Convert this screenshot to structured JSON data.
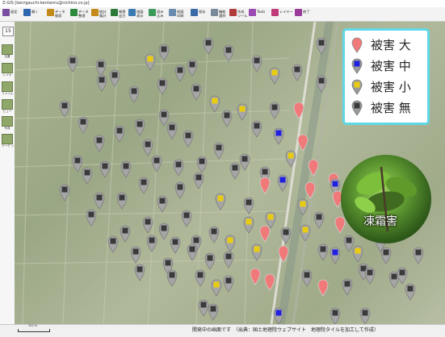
{
  "window": {
    "title": "Z-GIS [kenrgauchi-kentanru@nichino.co.jp]"
  },
  "toolbar": {
    "buttons": [
      {
        "label": "設定",
        "icon": "gear-icon",
        "color": "#7a4ea0"
      },
      {
        "label": "開く",
        "icon": "folder-icon",
        "color": "#2f66b0"
      },
      {
        "label": "データ\n検索",
        "icon": "search-icon",
        "color": "#c28a1a"
      },
      {
        "label": "データ\n整理",
        "icon": "text-tool-icon",
        "color": "#2b8a3e"
      },
      {
        "label": "統計\n集計",
        "icon": "stats-icon",
        "color": "#c48a1a"
      },
      {
        "label": "帳票\n出力",
        "icon": "report-icon",
        "color": "#2b7a3a"
      },
      {
        "label": "地図\n表示",
        "icon": "map-display-icon",
        "color": "#3a7ab0"
      },
      {
        "label": "読み\n込み",
        "icon": "import-icon",
        "color": "#3a9a5a"
      },
      {
        "label": "地図\n印刷",
        "icon": "print-icon",
        "color": "#6a8ab0"
      },
      {
        "label": "保存",
        "icon": "save-icon",
        "color": "#3a6aa8"
      },
      {
        "label": "機能\n選択",
        "icon": "function-icon",
        "color": "#7a8a9a"
      },
      {
        "label": "作成\nツール",
        "icon": "create-tool-icon",
        "color": "#b03a3a"
      },
      {
        "label": "Tools",
        "icon": "tools-icon",
        "color": "#9a4ab0"
      },
      {
        "label": "レイヤー",
        "icon": "layer-icon",
        "color": "#c03a7a"
      },
      {
        "label": "終了",
        "icon": "exit-icon",
        "color": "#9a3a9a"
      }
    ]
  },
  "sidebar": {
    "zoom": "15",
    "items": [
      {
        "label": "位置",
        "icon": "position-icon"
      },
      {
        "label": "レイヤ",
        "icon": "layer-icon"
      },
      {
        "label": "ファイル",
        "icon": "excel-file-icon"
      },
      {
        "label": "ビュー",
        "icon": "view-icon"
      },
      {
        "label": "写真",
        "icon": "photo-icon"
      },
      {
        "label": "ワーク\nシート作成",
        "icon": "worksheet-icon"
      }
    ]
  },
  "legend": {
    "items": [
      {
        "label": "被害 大",
        "color": "#f07a7a"
      },
      {
        "label": "被害 中",
        "color": "#2020e0"
      },
      {
        "label": "被害 小",
        "color": "#e8cc10"
      },
      {
        "label": "被害 無",
        "color": "#3a3a3a"
      }
    ]
  },
  "photo": {
    "label": "凍霜害"
  },
  "status": {
    "message": "開発中の画面です　（出典：国土地理院ウェブサイト　地理院タイルを加工して作成）",
    "scale_label": "300 m"
  }
}
